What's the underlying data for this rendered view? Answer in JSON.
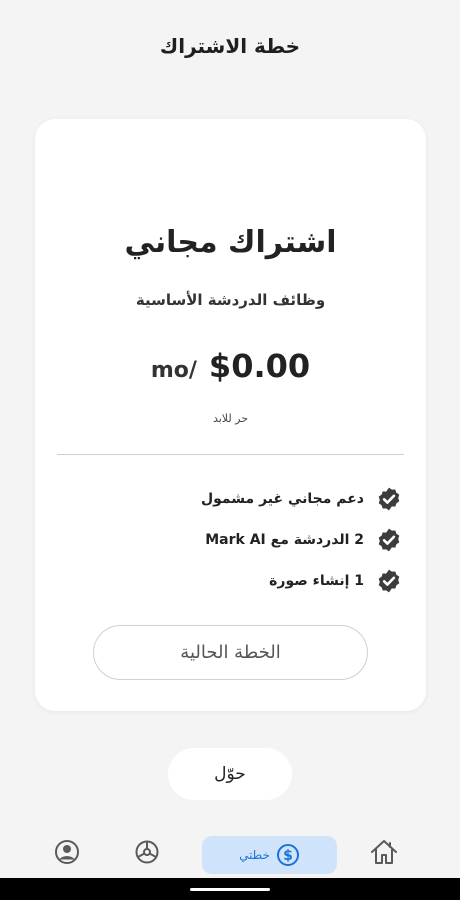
{
  "header": {
    "title": "خطة الاشتراك"
  },
  "plan": {
    "name": "اشتراك مجاني",
    "description": "وظائف الدردشة الأساسية",
    "price": "$0.00",
    "period": "mo/",
    "note": "حر للابد",
    "features": [
      {
        "text": "دعم مجاني غير مشمول",
        "icon": "verified-check-icon"
      },
      {
        "text": "2 الدردشة مع Mark AI",
        "icon": "verified-check-icon"
      },
      {
        "text": "1 إنشاء صورة",
        "icon": "verified-check-icon"
      }
    ],
    "current_plan_label": "الخطة الحالية"
  },
  "switch_button": {
    "label": "حوّل"
  },
  "bottom_nav": {
    "items": [
      {
        "name": "home",
        "icon": "home-icon",
        "label": ""
      },
      {
        "name": "plan",
        "icon": "dollar-circle-icon",
        "label": "خطتي",
        "active": true
      },
      {
        "name": "settings",
        "icon": "gear-icon",
        "label": ""
      },
      {
        "name": "profile",
        "icon": "profile-icon",
        "label": ""
      }
    ]
  },
  "colors": {
    "background": "#f4f4f4",
    "card": "#ffffff",
    "accent": "#1a73d9",
    "nav_active_bg": "#cfe4fb",
    "check": "#3c3c3c"
  }
}
